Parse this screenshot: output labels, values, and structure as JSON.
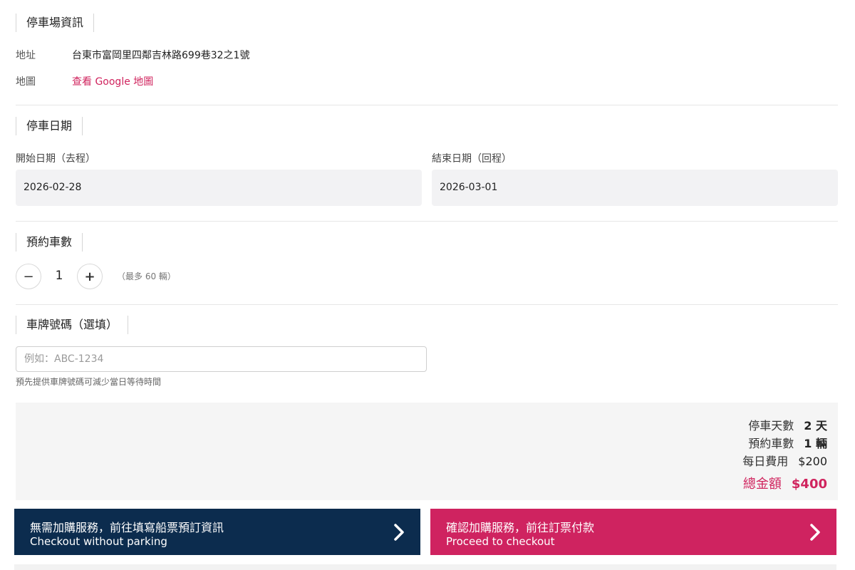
{
  "parking_info": {
    "title": "停車場資訊",
    "address_label": "地址",
    "address_value": "台東市富岡里四鄰吉林路699巷32之1號",
    "map_label": "地圖",
    "map_link": "查看 Google 地圖"
  },
  "parking_dates": {
    "title": "停車日期",
    "start_label": "開始日期（去程）",
    "start_value": "2026-02-28",
    "end_label": "結束日期（回程）",
    "end_value": "2026-03-01"
  },
  "vehicle_count": {
    "title": "預約車數",
    "minus_symbol": "−",
    "value": "1",
    "plus_symbol": "+",
    "hint": "（最多 60 輛）"
  },
  "plate": {
    "title": "車牌號碼（選填）",
    "placeholder": "例如：ABC-1234",
    "value": "",
    "hint": "預先提供車牌號碼可減少當日等待時間"
  },
  "summary": {
    "days_label": "停車天數",
    "days_value": "2 天",
    "vehicles_label": "預約車數",
    "vehicles_value": "1 輛",
    "daily_fee_label": "每日費用",
    "daily_fee_value": "$200",
    "total_label": "總金額",
    "total_value": "$400"
  },
  "actions": {
    "skip_main": "無需加購服務，前往填寫船票預訂資訊",
    "skip_sub": "Checkout without parking",
    "confirm_main": "確認加購服務，前往訂票付款",
    "confirm_sub": "Proceed to checkout"
  },
  "colors": {
    "accent": "#d0245e",
    "dark_button": "#0c2c4e",
    "pink_button": "#cf2360"
  }
}
